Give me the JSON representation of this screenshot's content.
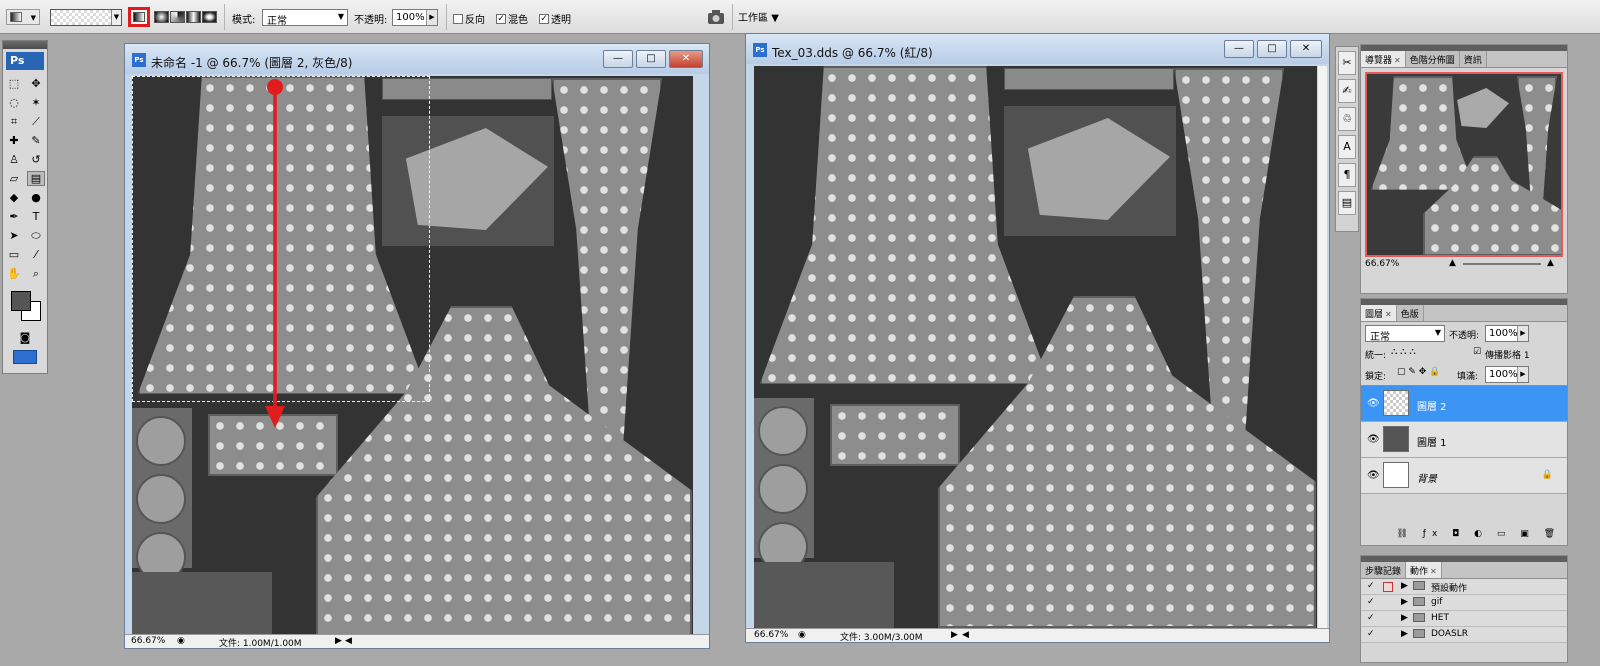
{
  "options_bar": {
    "mode_label": "模式:",
    "mode_value": "正常",
    "opacity_label": "不透明:",
    "opacity_value": "100%",
    "reverse_label": "反向",
    "dither_label": "混色",
    "transparency_label": "透明",
    "reverse_checked": false,
    "dither_checked": true,
    "transparency_checked": true,
    "workspace_label": "工作區"
  },
  "tools": {
    "logo": "Ps"
  },
  "doc1": {
    "title": "未命名 -1 @ 66.7% (圖層 2, 灰色/8)",
    "zoom": "66.67%",
    "file_info": "文件: 1.00M/1.00M"
  },
  "doc2": {
    "title": "Tex_03.dds @ 66.7% (紅/8)",
    "zoom": "66.67%",
    "file_info": "文件: 3.00M/3.00M"
  },
  "navigator": {
    "tabs": [
      "導覽器",
      "色階分佈圖",
      "資訊"
    ],
    "zoom": "66.67%"
  },
  "layers_panel": {
    "tabs": [
      "圖層",
      "色版"
    ],
    "blend_mode": "正常",
    "opacity_label": "不透明:",
    "opacity_value": "100%",
    "unify_label": "統一:",
    "propagate_label": "傳播影格 1",
    "lock_label": "鎖定:",
    "fill_label": "填滿:",
    "fill_value": "100%",
    "layers": [
      {
        "name": "圖層 2",
        "selected": true
      },
      {
        "name": "圖層 1",
        "selected": false
      },
      {
        "name": "背景",
        "selected": false
      }
    ]
  },
  "actions_panel": {
    "tabs": [
      "步驟記錄",
      "動作"
    ],
    "items": [
      "預設動作",
      "gif",
      "HET",
      "DOASLR"
    ]
  },
  "colors": {
    "accent_red": "#e21c1c",
    "selected_layer": "#3c94f5"
  }
}
